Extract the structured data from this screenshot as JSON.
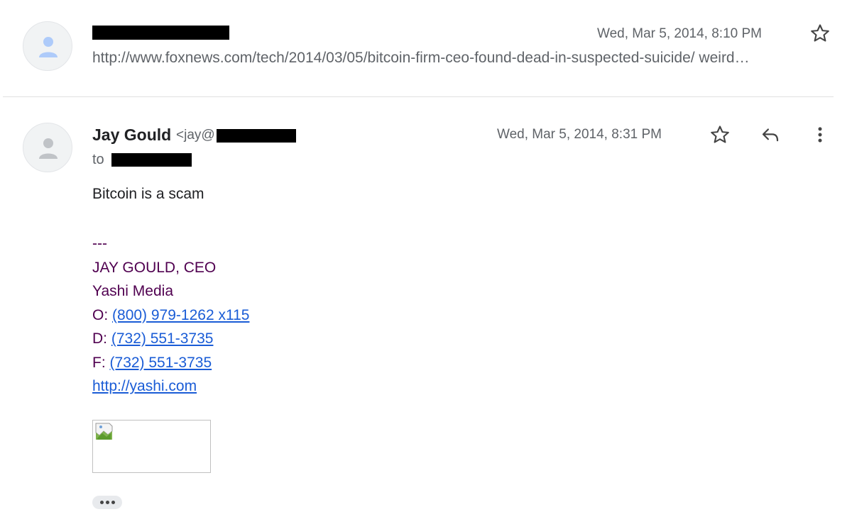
{
  "thread": {
    "message_1": {
      "date": "Wed, Mar 5, 2014, 8:10 PM",
      "snippet": "http://www.foxnews.com/tech/2014/03/05/bitcoin-firm-ceo-found-dead-in-suspected-suicide/ weird…"
    },
    "message_2": {
      "sender_name": "Jay Gould",
      "sender_email_prefix": "<jay@",
      "to_label": "to",
      "date": "Wed, Mar 5, 2014, 8:31 PM",
      "body": "Bitcoin is a scam",
      "signature": {
        "separator": "---",
        "title": "JAY GOULD, CEO",
        "company": "Yashi Media",
        "office_label": "O:",
        "office_phone": "(800) 979-1262 x115",
        "direct_label": "D:",
        "direct_phone": "(732) 551-3735",
        "fax_label": "F:",
        "fax_phone": "(732) 551-3735",
        "website": "http://yashi.com"
      }
    }
  },
  "icons": {
    "avatar": "person-icon",
    "star": "star-icon",
    "reply": "reply-icon",
    "more": "more-vert-icon",
    "broken_image": "broken-image-icon",
    "trimmed": "trimmed-content-icon"
  },
  "colors": {
    "signature": "#500050",
    "link": "#1a5cd6",
    "secondary_text": "#5f6368"
  }
}
